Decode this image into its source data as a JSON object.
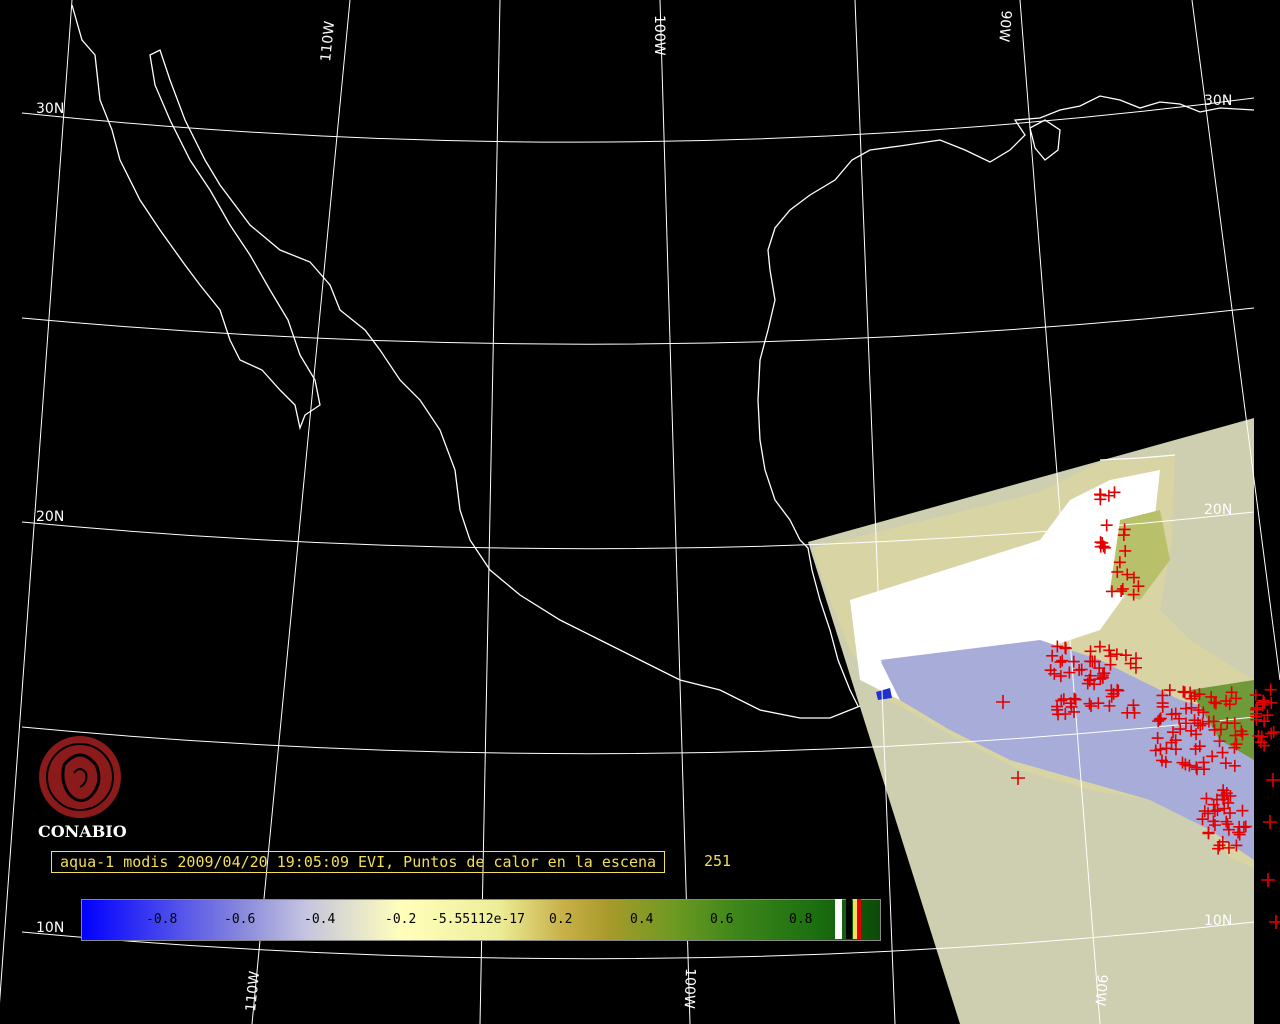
{
  "map": {
    "logo": {
      "text": "CONABIO"
    },
    "caption": "aqua-1 modis 2009/04/20 19:05:09 EVI, Puntos de calor en la escena",
    "hotspot_count": "251",
    "grid_labels": {
      "lat_30n_left": "30N",
      "lat_30n_right": "30N",
      "lat_20n_left": "20N",
      "lat_20n_right": "20N",
      "lat_10n_left": "10N",
      "lat_10n_right": "10N",
      "lon_110w_top": "110W",
      "lon_100w_top": "100W",
      "lon_90w_top": "90W",
      "lon_110w_bottom": "110W",
      "lon_100w_bottom": "100W",
      "lon_90w_bottom": "90W"
    },
    "colorbar": {
      "labels": [
        "-0.8",
        "-0.6",
        "-0.4",
        "-0.2",
        "-5.55112e-17",
        "0.2",
        "0.4",
        "0.6",
        "0.8"
      ]
    },
    "colors": {
      "background": "#000000",
      "coastline": "#ffffff",
      "caption": "#f2df52",
      "swath": "#ceceb0",
      "hotspot": "#e30000",
      "logo": "#8b1a1a"
    }
  }
}
